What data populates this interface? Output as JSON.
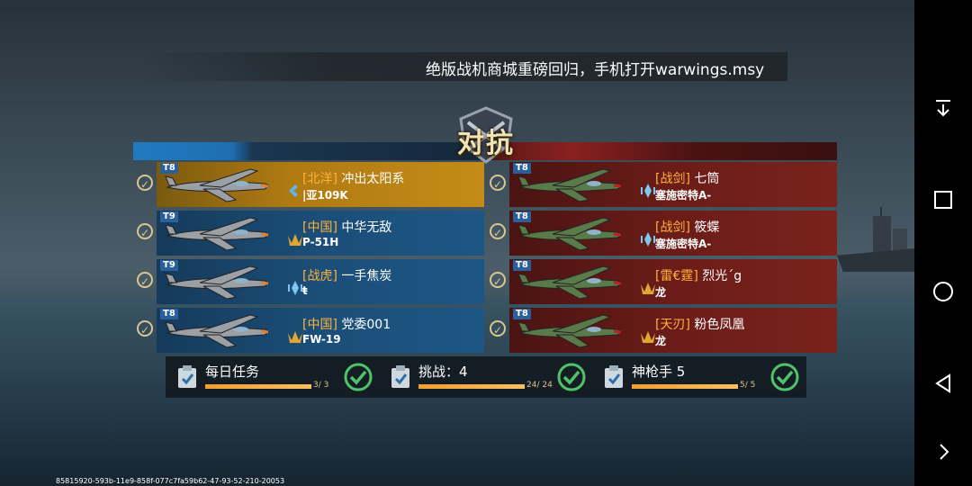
{
  "marquee_text": "绝版战机商城重磅回归，手机打开warwings.msy",
  "mode_title": "对抗",
  "blue_team": [
    {
      "tier": "T8",
      "tag": "[北洋]",
      "name": "冲出太阳系",
      "plane": "|亚109K",
      "role_icon": "fighter-icon",
      "selected": true
    },
    {
      "tier": "T9",
      "tag": "[中国]",
      "name": "中华无敌",
      "plane": "P-51H",
      "role_icon": "attacker-icon",
      "selected": false
    },
    {
      "tier": "T9",
      "tag": "[战虎]",
      "name": "一手焦炭",
      "plane": "ŧ",
      "role_icon": "interceptor-icon",
      "selected": false
    },
    {
      "tier": "T8",
      "tag": "[中国]",
      "name": "党委001",
      "plane": "FW-19",
      "role_icon": "attacker-icon",
      "selected": false
    }
  ],
  "red_team": [
    {
      "tier": "T8",
      "tag": "[战剑]",
      "name": "七筒",
      "plane": "塞施密特A-",
      "role_icon": "interceptor-icon"
    },
    {
      "tier": "T8",
      "tag": "[战剑]",
      "name": "筱蝶",
      "plane": "塞施密特A-",
      "role_icon": "interceptor-icon"
    },
    {
      "tier": "T8",
      "tag": "[雷€霆]",
      "name": "烈光´g",
      "plane": "龙",
      "role_icon": "attacker-icon"
    },
    {
      "tier": "T8",
      "tag": "[天刃]",
      "name": "粉色凤凰",
      "plane": "龙",
      "role_icon": "attacker-icon"
    }
  ],
  "tasks": [
    {
      "label": "每日任务",
      "count": "3/ 3",
      "progress": 1.0
    },
    {
      "label": "挑战：4",
      "count": "24/ 24",
      "progress": 1.0
    },
    {
      "label": "神枪手 5",
      "count": "5/ 5",
      "progress": 1.0
    }
  ],
  "footer_id": "85815920-593b-11e9-858f-077c7fa59b62-47-93-52-210-20053",
  "colors": {
    "blue_card": "#1b4e78",
    "gold_card": "#b07a12",
    "red_card": "#6b1c18",
    "accent_orange": "#ffb23a"
  }
}
